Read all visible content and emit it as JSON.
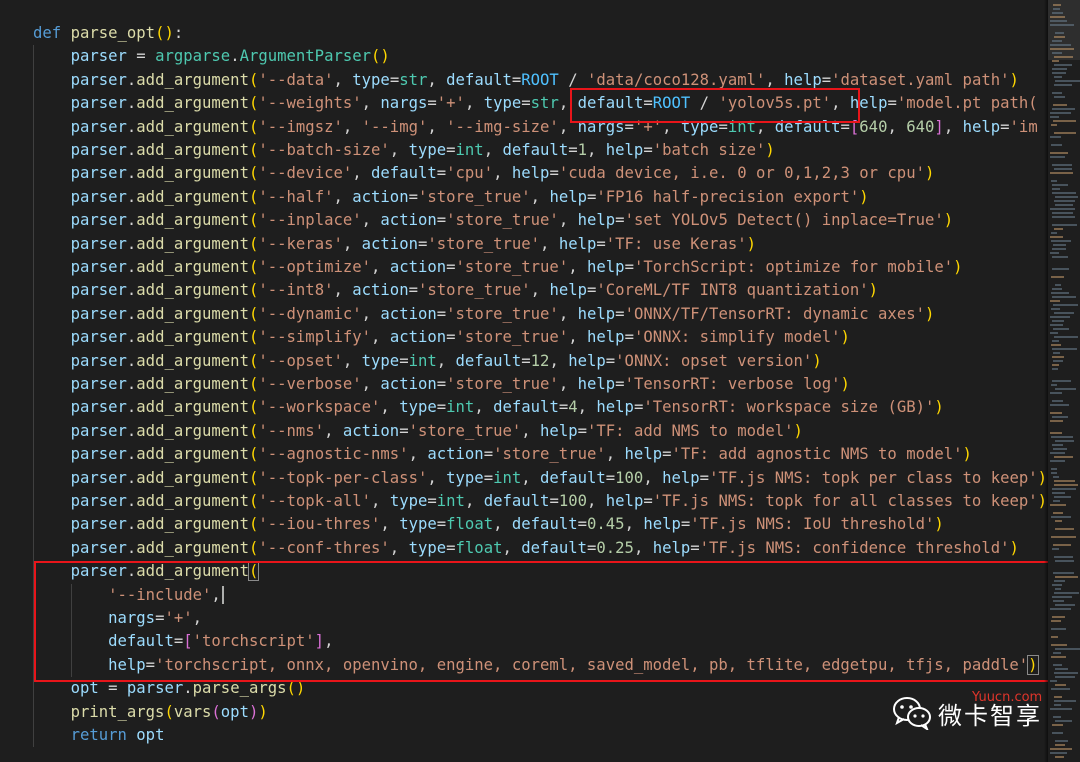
{
  "code": {
    "def_line": {
      "kw": "def",
      "fn": "parse_opt",
      "paren_open": "(",
      "paren_close": ")",
      "colon": ":"
    },
    "parser_line": {
      "var": "parser",
      "eq": " = ",
      "module": "argparse",
      "dot": ".",
      "cls": "ArgumentParser",
      "parens": "()"
    },
    "call_prefix": {
      "obj": "parser",
      "dot": ".",
      "method": "add_argument"
    },
    "args": [
      [
        "'--data'",
        ", ",
        "type",
        "=",
        "str",
        ", ",
        "default",
        "=",
        "ROOT",
        " / ",
        "'data/coco128.yaml'",
        ", ",
        "help",
        "=",
        "'dataset.yaml path'"
      ],
      [
        "'--weights'",
        ", ",
        "nargs",
        "=",
        "'+'",
        ", ",
        "type",
        "=",
        "str",
        ", ",
        "default",
        "=",
        "ROOT",
        " / ",
        "'yolov5s.pt'",
        ", ",
        "help",
        "=",
        "'model.pt path("
      ],
      [
        "'--imgsz'",
        ", ",
        "'--img'",
        ", ",
        "'--img-size'",
        ", ",
        "nargs",
        "=",
        "'+'",
        ", ",
        "type",
        "=",
        "int",
        ", ",
        "default",
        "=",
        "[",
        "640",
        ", ",
        "640",
        "]",
        ", ",
        "help",
        "=",
        "'im"
      ],
      [
        "'--batch-size'",
        ", ",
        "type",
        "=",
        "int",
        ", ",
        "default",
        "=",
        "1",
        ", ",
        "help",
        "=",
        "'batch size'"
      ],
      [
        "'--device'",
        ", ",
        "default",
        "=",
        "'cpu'",
        ", ",
        "help",
        "=",
        "'cuda device, i.e. 0 or 0,1,2,3 or cpu'"
      ],
      [
        "'--half'",
        ", ",
        "action",
        "=",
        "'store_true'",
        ", ",
        "help",
        "=",
        "'FP16 half-precision export'"
      ],
      [
        "'--inplace'",
        ", ",
        "action",
        "=",
        "'store_true'",
        ", ",
        "help",
        "=",
        "'set YOLOv5 Detect() inplace=True'"
      ],
      [
        "'--keras'",
        ", ",
        "action",
        "=",
        "'store_true'",
        ", ",
        "help",
        "=",
        "'TF: use Keras'"
      ],
      [
        "'--optimize'",
        ", ",
        "action",
        "=",
        "'store_true'",
        ", ",
        "help",
        "=",
        "'TorchScript: optimize for mobile'"
      ],
      [
        "'--int8'",
        ", ",
        "action",
        "=",
        "'store_true'",
        ", ",
        "help",
        "=",
        "'CoreML/TF INT8 quantization'"
      ],
      [
        "'--dynamic'",
        ", ",
        "action",
        "=",
        "'store_true'",
        ", ",
        "help",
        "=",
        "'ONNX/TF/TensorRT: dynamic axes'"
      ],
      [
        "'--simplify'",
        ", ",
        "action",
        "=",
        "'store_true'",
        ", ",
        "help",
        "=",
        "'ONNX: simplify model'"
      ],
      [
        "'--opset'",
        ", ",
        "type",
        "=",
        "int",
        ", ",
        "default",
        "=",
        "12",
        ", ",
        "help",
        "=",
        "'ONNX: opset version'"
      ],
      [
        "'--verbose'",
        ", ",
        "action",
        "=",
        "'store_true'",
        ", ",
        "help",
        "=",
        "'TensorRT: verbose log'"
      ],
      [
        "'--workspace'",
        ", ",
        "type",
        "=",
        "int",
        ", ",
        "default",
        "=",
        "4",
        ", ",
        "help",
        "=",
        "'TensorRT: workspace size (GB)'"
      ],
      [
        "'--nms'",
        ", ",
        "action",
        "=",
        "'store_true'",
        ", ",
        "help",
        "=",
        "'TF: add NMS to model'"
      ],
      [
        "'--agnostic-nms'",
        ", ",
        "action",
        "=",
        "'store_true'",
        ", ",
        "help",
        "=",
        "'TF: add agnostic NMS to model'"
      ],
      [
        "'--topk-per-class'",
        ", ",
        "type",
        "=",
        "int",
        ", ",
        "default",
        "=",
        "100",
        ", ",
        "help",
        "=",
        "'TF.js NMS: topk per class to keep'"
      ],
      [
        "'--topk-all'",
        ", ",
        "type",
        "=",
        "int",
        ", ",
        "default",
        "=",
        "100",
        ", ",
        "help",
        "=",
        "'TF.js NMS: topk for all classes to keep'"
      ],
      [
        "'--iou-thres'",
        ", ",
        "type",
        "=",
        "float",
        ", ",
        "default",
        "=",
        "0.45",
        ", ",
        "help",
        "=",
        "'TF.js NMS: IoU threshold'"
      ],
      [
        "'--conf-thres'",
        ", ",
        "type",
        "=",
        "float",
        ", ",
        "default",
        "=",
        "0.25",
        ", ",
        "help",
        "=",
        "'TF.js NMS: confidence threshold'"
      ]
    ],
    "include_block": {
      "open": "(",
      "name": "'--include'",
      "comma": ",",
      "nargs_kw": "nargs",
      "nargs_val": "'+'",
      "default_kw": "default",
      "default_val": "'torchscript'",
      "help_kw": "help",
      "help_val": "'torchscript, onnx, openvino, engine, coreml, saved_model, pb, tflite, edgetpu, tfjs, paddle'",
      "close": ")"
    },
    "opt_line": {
      "var": "opt",
      "eq": " = ",
      "obj": "parser",
      "dot": ".",
      "method": "parse_args",
      "parens": "()"
    },
    "print_line": {
      "fn": "print_args",
      "open": "(",
      "inner_fn": "vars",
      "inner_open": "(",
      "arg": "opt",
      "inner_close": ")",
      "close": ")"
    },
    "return_line": {
      "kw": "return",
      "val": "opt"
    }
  },
  "colors": {
    "keyword": "#569cd6",
    "function": "#dcdcaa",
    "variable": "#9cdcfe",
    "class": "#4ec9b0",
    "string": "#ce9178",
    "number": "#b5cea8",
    "constant": "#4fc1ff",
    "highlight_box": "#e8151a"
  },
  "watermark": {
    "icon": "wechat-icon",
    "text": "微卡智享",
    "site": "Yuucn.com"
  }
}
